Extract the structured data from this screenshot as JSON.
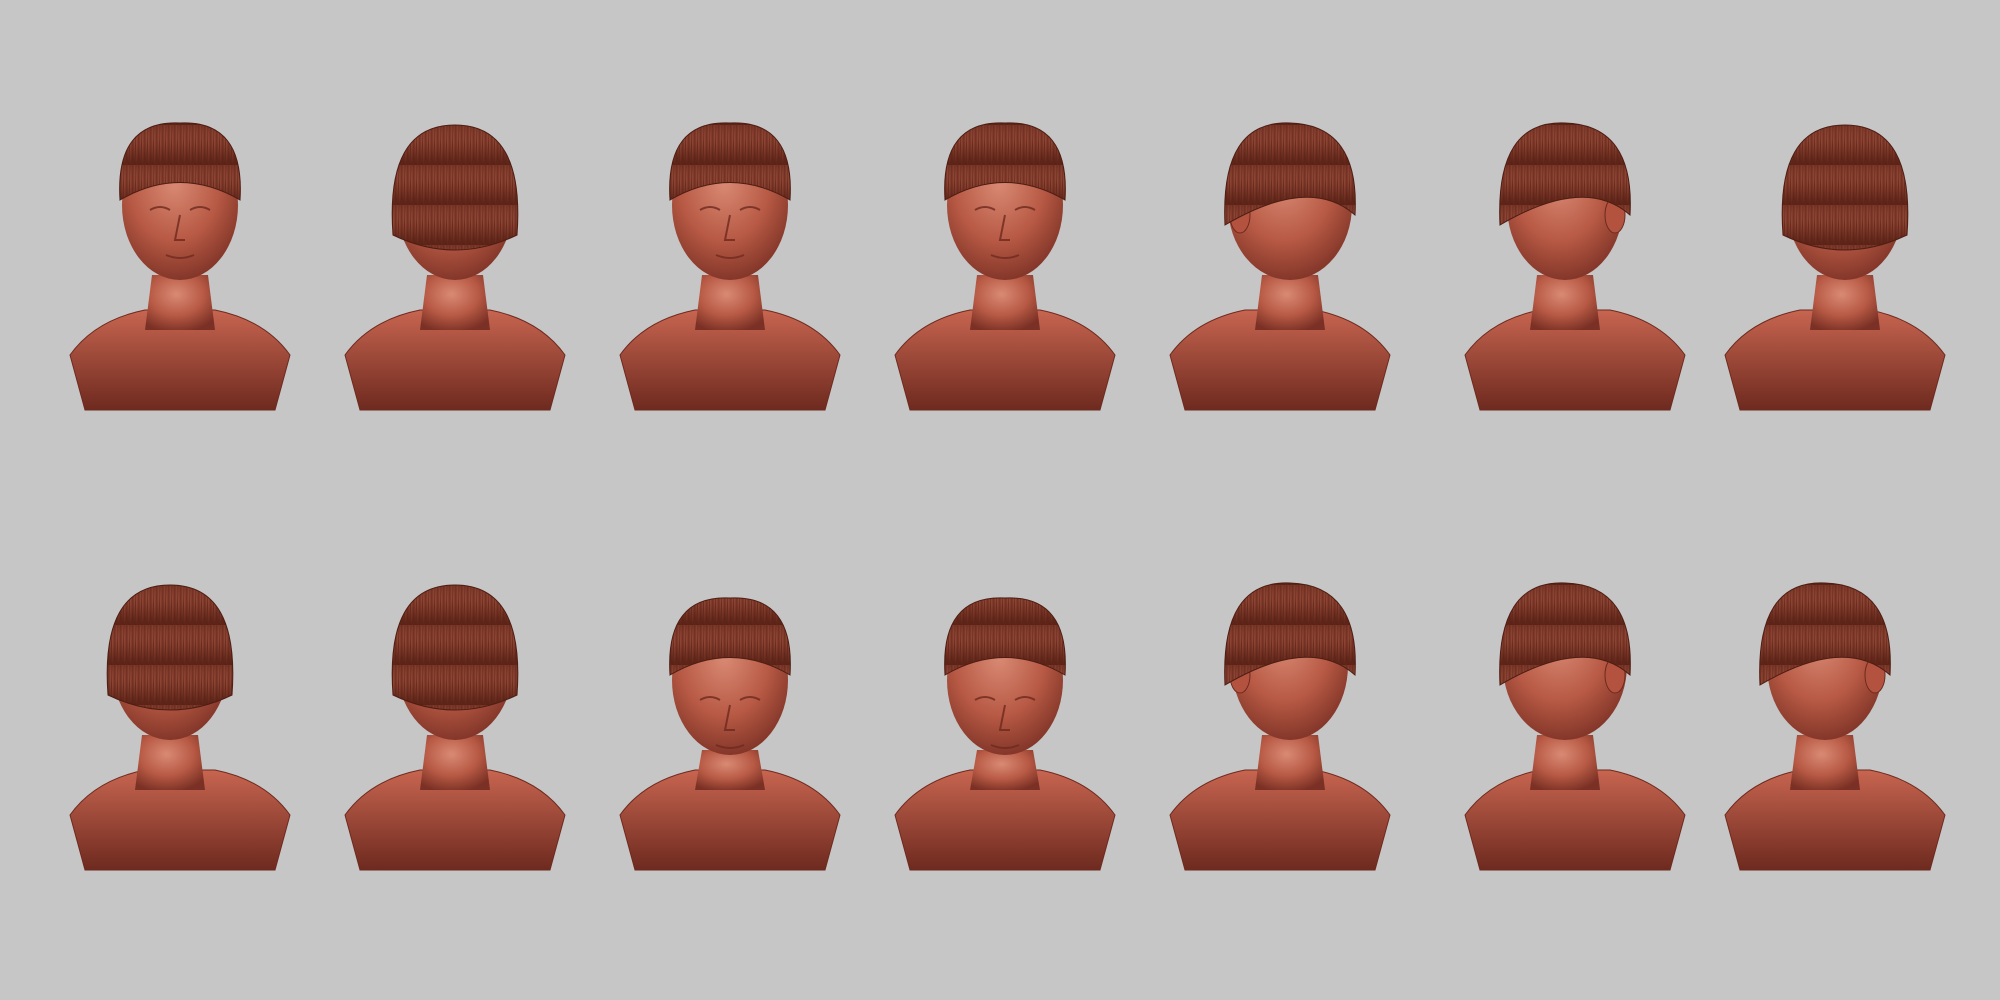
{
  "scene": {
    "background_color": "#c6c6c6",
    "clay_color": "#b0513f",
    "clay_highlight": "#cf7a66",
    "clay_shadow": "#6e2a1f",
    "hair_color": "#8a3a2b",
    "rows": [
      {
        "name": "top-row",
        "views": [
          "front-tilted",
          "back-side-tilted",
          "front-three-quarter",
          "front",
          "right-profile",
          "left-three-quarter",
          "back-right"
        ]
      },
      {
        "name": "bottom-row",
        "views": [
          "back-left",
          "back",
          "front-looking-down",
          "down-tilted",
          "right-three-quarter",
          "left-profile",
          "left-three-quarter"
        ]
      }
    ]
  }
}
